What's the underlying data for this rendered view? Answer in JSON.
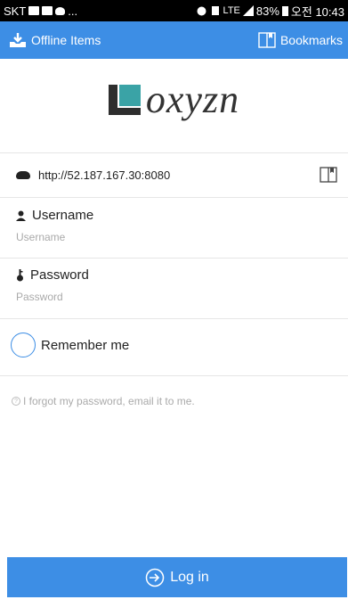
{
  "statusbar": {
    "carrier": "SKT",
    "ellipsis": "...",
    "network": "LTE",
    "battery": "83%",
    "time": "오전 10:43"
  },
  "appbar": {
    "offline_label": "Offline Items",
    "bookmarks_label": "Bookmarks"
  },
  "logo": {
    "text": "oxyzn"
  },
  "server": {
    "url": "http://52.187.167.30:8080"
  },
  "username": {
    "label": "Username",
    "placeholder": "Username",
    "value": ""
  },
  "password": {
    "label": "Password",
    "placeholder": "Password",
    "value": ""
  },
  "remember": {
    "label": "Remember me"
  },
  "forgot": {
    "text": "I forgot my password, email it to me."
  },
  "login": {
    "label": "Log in"
  },
  "colors": {
    "accent": "#3d8ee5",
    "logo_teal": "#3aa3a6",
    "logo_dark": "#2e2e2e"
  }
}
